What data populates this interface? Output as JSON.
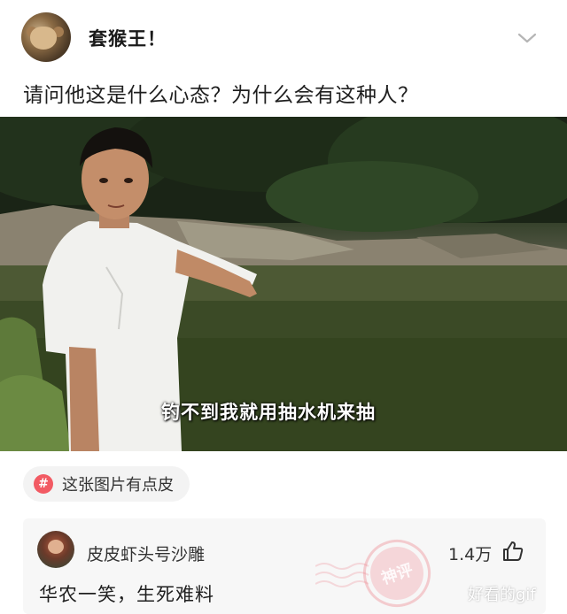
{
  "post": {
    "username": "套猴王！",
    "text": "请问他这是什么心态？为什么会有这种人？",
    "video_subtitle": "钓不到我就用抽水机来抽"
  },
  "topic_tag": {
    "icon": "hash-icon",
    "label": "这张图片有点皮"
  },
  "comment": {
    "username": "皮皮虾头号沙雕",
    "like_count": "1.4万",
    "text": "华农一笑，生死难料",
    "stamp_label": "神评"
  },
  "watermark": "好看的gif",
  "colors": {
    "accent": "#f25a63",
    "card_bg": "#f7f7f7",
    "tag_bg": "#f3f3f3"
  }
}
